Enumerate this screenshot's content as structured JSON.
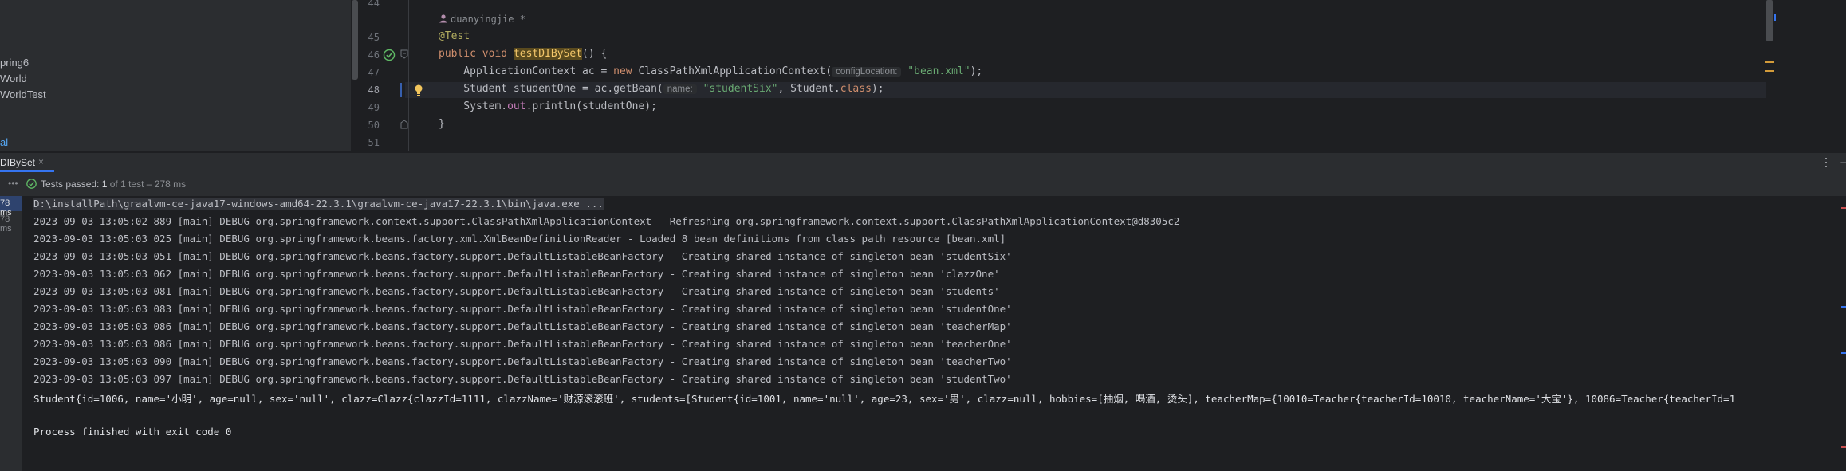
{
  "project_tree": {
    "items": [
      "pring6",
      "World",
      "WorldTest",
      "al"
    ]
  },
  "editor": {
    "author_hint": "duanyingjie *",
    "line_numbers": [
      "44",
      "45",
      "46",
      "47",
      "48",
      "49",
      "50",
      "51"
    ],
    "line45": {
      "annotation": "@Test"
    },
    "line46": {
      "kw1": "public",
      "kw2": "void",
      "method": "testDIBySet",
      "rest": "() {"
    },
    "line47": {
      "pre": "    ApplicationContext ac = ",
      "kw_new": "new",
      "cls": " ClassPathXmlApplicationContext(",
      "hint": "configLocation:",
      "str": "\"bean.xml\"",
      "post": ");"
    },
    "line48": {
      "pre": "    Student studentOne = ac.getBean(",
      "hint": "name:",
      "str": "\"studentSix\"",
      "post": ", Student.",
      "kw_class": "class",
      "end": ");"
    },
    "line49": {
      "pre": "    System.",
      "field": "out",
      "post": ".println(studentOne);"
    },
    "line50": {
      "text": "}"
    }
  },
  "tool_window": {
    "tab_label": "DIBySet",
    "tab_close": "×",
    "menu_icon": "⋮",
    "minimize_icon": "–"
  },
  "status": {
    "label": "Tests passed:",
    "passed": "1",
    "rest": "of 1 test – 278 ms"
  },
  "test_tree": {
    "items": [
      "78 ms",
      "78 ms"
    ]
  },
  "console": {
    "lines": [
      "D:\\installPath\\graalvm-ce-java17-windows-amd64-22.3.1\\graalvm-ce-java17-22.3.1\\bin\\java.exe ...",
      "2023-09-03 13:05:02 889 [main] DEBUG org.springframework.context.support.ClassPathXmlApplicationContext - Refreshing org.springframework.context.support.ClassPathXmlApplicationContext@d8305c2",
      "2023-09-03 13:05:03 025 [main] DEBUG org.springframework.beans.factory.xml.XmlBeanDefinitionReader - Loaded 8 bean definitions from class path resource [bean.xml]",
      "2023-09-03 13:05:03 051 [main] DEBUG org.springframework.beans.factory.support.DefaultListableBeanFactory - Creating shared instance of singleton bean 'studentSix'",
      "2023-09-03 13:05:03 062 [main] DEBUG org.springframework.beans.factory.support.DefaultListableBeanFactory - Creating shared instance of singleton bean 'clazzOne'",
      "2023-09-03 13:05:03 081 [main] DEBUG org.springframework.beans.factory.support.DefaultListableBeanFactory - Creating shared instance of singleton bean 'students'",
      "2023-09-03 13:05:03 083 [main] DEBUG org.springframework.beans.factory.support.DefaultListableBeanFactory - Creating shared instance of singleton bean 'studentOne'",
      "2023-09-03 13:05:03 086 [main] DEBUG org.springframework.beans.factory.support.DefaultListableBeanFactory - Creating shared instance of singleton bean 'teacherMap'",
      "2023-09-03 13:05:03 086 [main] DEBUG org.springframework.beans.factory.support.DefaultListableBeanFactory - Creating shared instance of singleton bean 'teacherOne'",
      "2023-09-03 13:05:03 090 [main] DEBUG org.springframework.beans.factory.support.DefaultListableBeanFactory - Creating shared instance of singleton bean 'teacherTwo'",
      "2023-09-03 13:05:03 097 [main] DEBUG org.springframework.beans.factory.support.DefaultListableBeanFactory - Creating shared instance of singleton bean 'studentTwo'",
      "Student{id=1006, name='小明', age=null, sex='null', clazz=Clazz{clazzId=1111, clazzName='财源滚滚班', students=[Student{id=1001, name='null', age=23, sex='男', clazz=null, hobbies=[抽烟, 喝酒, 烫头], teacherMap={10010=Teacher{teacherId=10010, teacherName='大宝'}, 10086=Teacher{teacherId=1",
      "",
      "Process finished with exit code 0"
    ]
  },
  "colors": {
    "accent": "#3574f0",
    "pass_green": "#5fb865",
    "keyword": "#cf8e6d",
    "string": "#6aab73",
    "method": "#56a8f5",
    "annotation": "#b3ae60"
  }
}
